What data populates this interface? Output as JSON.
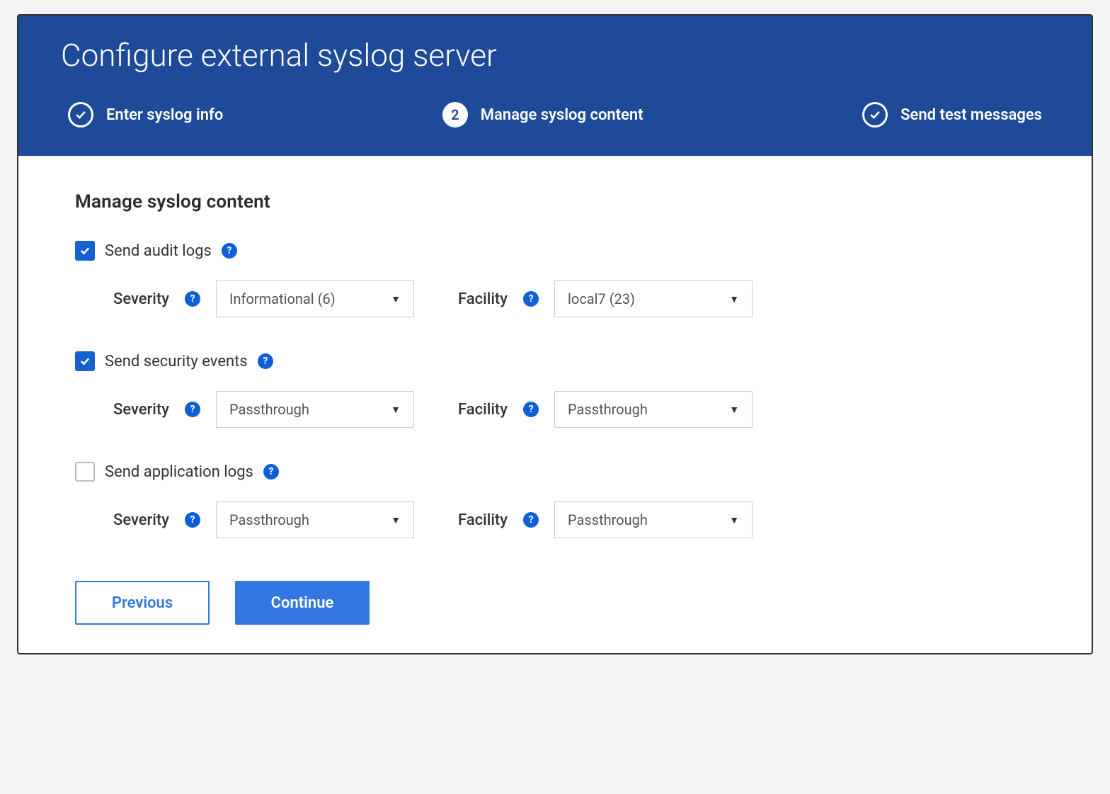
{
  "header": {
    "title": "Configure external syslog server",
    "steps": [
      {
        "label": "Enter syslog info",
        "state": "done"
      },
      {
        "label": "Manage syslog content",
        "state": "current",
        "num": "2"
      },
      {
        "label": "Send test messages",
        "state": "done"
      }
    ]
  },
  "section": {
    "title": "Manage syslog content",
    "severity_label": "Severity",
    "facility_label": "Facility",
    "options": {
      "audit": {
        "label": "Send audit logs",
        "checked": true,
        "severity": "Informational (6)",
        "facility": "local7 (23)"
      },
      "security": {
        "label": "Send security events",
        "checked": true,
        "severity": "Passthrough",
        "facility": "Passthrough"
      },
      "application": {
        "label": "Send application logs",
        "checked": false,
        "severity": "Passthrough",
        "facility": "Passthrough"
      }
    }
  },
  "buttons": {
    "previous": "Previous",
    "continue": "Continue"
  }
}
